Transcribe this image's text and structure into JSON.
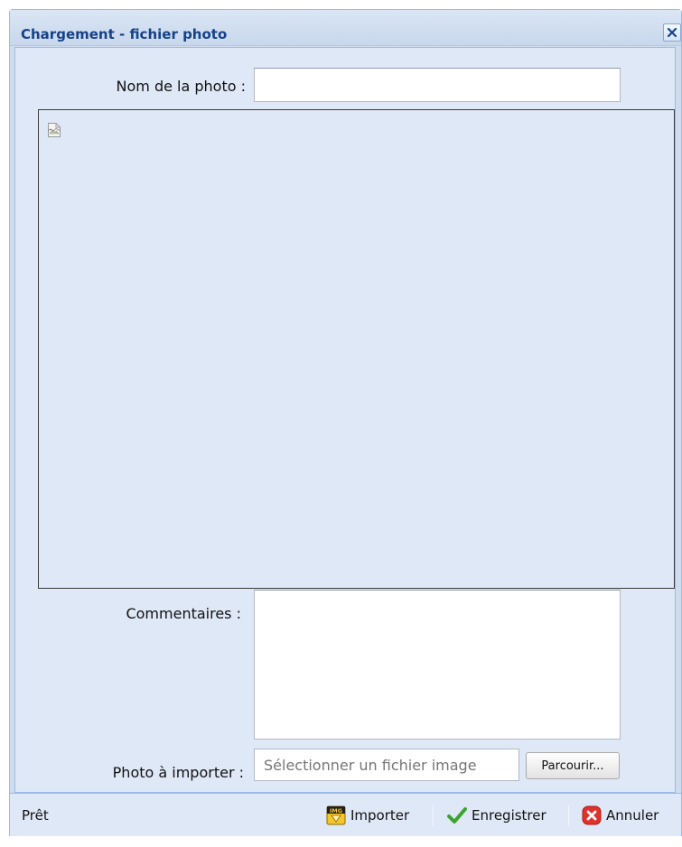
{
  "window": {
    "title": "Chargement - fichier photo",
    "close_icon": "close-icon"
  },
  "form": {
    "name_label": "Nom de la photo :",
    "name_value": "",
    "preview_icon": "broken-image-icon",
    "comments_label": "Commentaires :",
    "comments_value": "",
    "file_label": "Photo à importer :",
    "file_placeholder": "Sélectionner un fichier image",
    "browse_label": "Parcourir..."
  },
  "statusbar": {
    "status": "Prêt",
    "buttons": [
      {
        "label": "Importer",
        "icon": "img-import-icon"
      },
      {
        "label": "Enregistrer",
        "icon": "checkmark-icon"
      },
      {
        "label": "Annuler",
        "icon": "cancel-icon"
      }
    ]
  },
  "colors": {
    "title": "#15428b",
    "panel_bg": "#dfe8f6",
    "border": "#99bbe8",
    "check_green": "#3aa52c",
    "cancel_red": "#e0322d"
  }
}
